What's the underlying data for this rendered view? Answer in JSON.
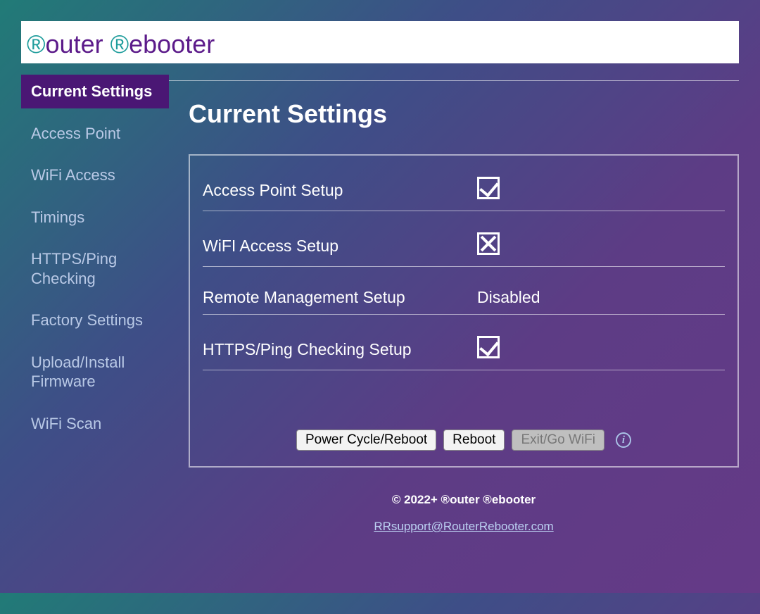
{
  "brand": {
    "prefix1": "®",
    "word1": "outer ",
    "prefix2": "®",
    "word2": "ebooter"
  },
  "sidebar": {
    "items": [
      {
        "label": "Current Settings",
        "active": true
      },
      {
        "label": "Access Point",
        "active": false
      },
      {
        "label": "WiFi Access",
        "active": false
      },
      {
        "label": "Timings",
        "active": false
      },
      {
        "label": "HTTPS/Ping Checking",
        "active": false
      },
      {
        "label": "Factory Settings",
        "active": false
      },
      {
        "label": "Upload/Install Firmware",
        "active": false
      },
      {
        "label": "WiFi Scan",
        "active": false
      }
    ]
  },
  "page_title": "Current Settings",
  "rows": [
    {
      "label": "Access Point Setup",
      "value_type": "check"
    },
    {
      "label": "WiFI Access Setup",
      "value_type": "cross"
    },
    {
      "label": "Remote Management Setup",
      "value_type": "text",
      "value_text": "Disabled"
    },
    {
      "label": "HTTPS/Ping Checking Setup",
      "value_type": "check"
    }
  ],
  "buttons": {
    "power_cycle": "Power Cycle/Reboot",
    "reboot": "Reboot",
    "exit": "Exit/Go WiFi"
  },
  "footer": {
    "copyright": "© 2022+ ®outer ®ebooter",
    "email": "RRsupport@RouterRebooter.com"
  }
}
